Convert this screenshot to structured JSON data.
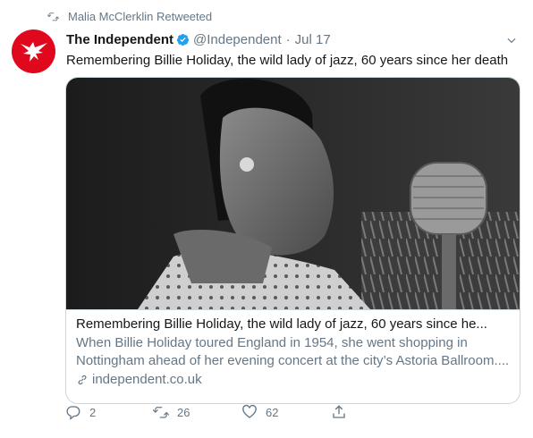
{
  "retweet": {
    "text": "Malia McClerklin Retweeted",
    "icon": "retweet-icon"
  },
  "author": {
    "name": "The Independent",
    "handle": "@Independent",
    "separator": "·",
    "date": "Jul 17",
    "verified": true,
    "avatar_color": "#e0081d",
    "avatar_icon": "eagle-logo-icon"
  },
  "tweet": {
    "text": "Remembering Billie Holiday, the wild lady of jazz, 60 years since her death"
  },
  "card": {
    "title": "Remembering Billie Holiday, the wild lady of jazz, 60 years since he...",
    "description_line1": "When Billie Holiday toured England in 1954, she went shopping in",
    "description_line2": "Nottingham ahead of her evening concert at the city’s Astoria Ballroom....",
    "domain": "independent.co.uk",
    "image_alt": "Black and white photo of Billie Holiday singing into a vintage microphone"
  },
  "actions": {
    "replies": "2",
    "retweets": "26",
    "likes": "62"
  },
  "colors": {
    "accent": "#1da1f2",
    "muted": "#657786",
    "border": "#ccd6dd",
    "text": "#14171a"
  }
}
